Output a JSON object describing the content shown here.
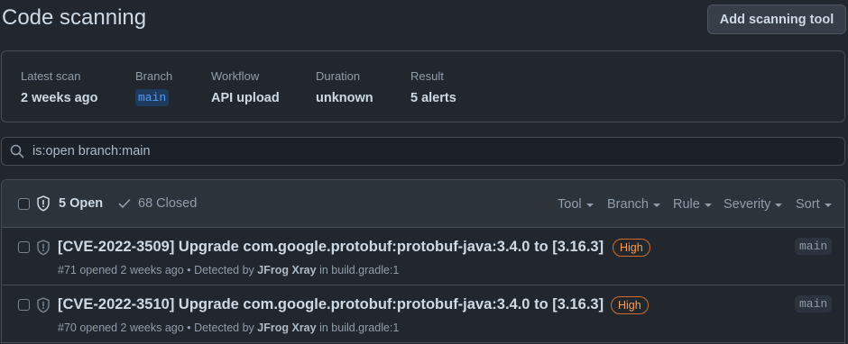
{
  "header": {
    "title": "Code scanning",
    "add_button": "Add scanning tool"
  },
  "summary": {
    "latest_scan": {
      "label": "Latest scan",
      "value": "2 weeks ago"
    },
    "branch": {
      "label": "Branch",
      "value": "main"
    },
    "workflow": {
      "label": "Workflow",
      "value": "API upload"
    },
    "duration": {
      "label": "Duration",
      "value": "unknown"
    },
    "result": {
      "label": "Result",
      "value": "5 alerts"
    }
  },
  "search": {
    "query": "is:open branch:main",
    "icon": "search-icon"
  },
  "list_header": {
    "open": "5 Open",
    "closed": "68 Closed",
    "filters": [
      "Tool",
      "Branch",
      "Rule",
      "Severity",
      "Sort"
    ]
  },
  "alerts": [
    {
      "title": "[CVE-2022-3509] Upgrade com.google.protobuf:protobuf-java:3.4.0 to [3.16.3]",
      "severity": "High",
      "number": "#71",
      "opened": "opened 2 weeks ago",
      "separator": "•",
      "detected_prefix": "Detected by",
      "tool": "JFrog Xray",
      "location_prefix": "in",
      "file": "build.gradle:1",
      "branch": "main"
    },
    {
      "title": "[CVE-2022-3510] Upgrade com.google.protobuf:protobuf-java:3.4.0 to [3.16.3]",
      "severity": "High",
      "number": "#70",
      "opened": "opened 2 weeks ago",
      "separator": "•",
      "detected_prefix": "Detected by",
      "tool": "JFrog Xray",
      "location_prefix": "in",
      "file": "build.gradle:1",
      "branch": "main"
    }
  ],
  "colors": {
    "background": "#22272e",
    "accent_blue": "#539bf5",
    "severity_high": "#f69d50"
  }
}
